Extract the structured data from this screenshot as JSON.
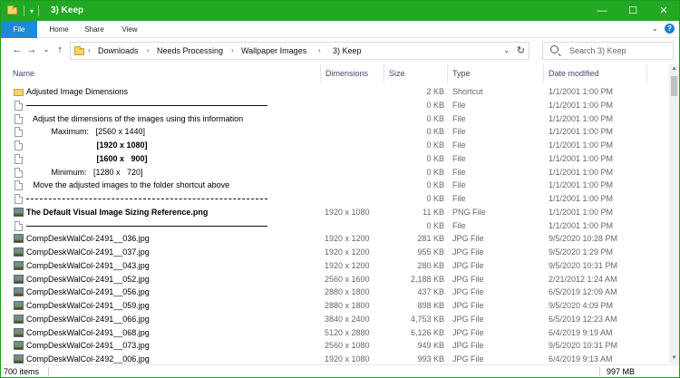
{
  "window": {
    "title": "3) Keep",
    "controls": {
      "minimize": "—",
      "maximize": "☐",
      "close": "✕"
    }
  },
  "ribbon": {
    "tabs": [
      "File",
      "Home",
      "Share",
      "View"
    ]
  },
  "navigation": {
    "back": "←",
    "forward": "→",
    "recent": "⌄",
    "up": "↑",
    "breadcrumb": [
      "Downloads",
      "Needs Processing",
      "Wallpaper Images",
      "3) Keep"
    ],
    "search_placeholder": "Search  3) Keep"
  },
  "columns": {
    "name": "Name",
    "dimensions": "Dimensions",
    "size": "Size",
    "type": "Type",
    "date": "Date modified"
  },
  "files": [
    {
      "icon": "folder-shortcut-icon",
      "name": "Adjusted Image Dimensions",
      "dim": "",
      "size": "2 KB",
      "type": "Shortcut",
      "date": "1/1/2001 1:00 PM",
      "style": "plain"
    },
    {
      "icon": "blank-file-icon",
      "name": "",
      "dim": "",
      "size": "0 KB",
      "type": "File",
      "date": "1/1/2001 1:00 PM",
      "style": "rule-solid"
    },
    {
      "icon": "blank-file-icon",
      "name": "   Adjust the dimensions of the images using this information",
      "dim": "",
      "size": "0 KB",
      "type": "File",
      "date": "1/1/2001 1:00 PM",
      "style": "plain"
    },
    {
      "icon": "blank-file-icon",
      "name": "           Maximum:   [2560 x 1440]",
      "dim": "",
      "size": "0 KB",
      "type": "File",
      "date": "1/1/2001 1:00 PM",
      "style": "plain"
    },
    {
      "icon": "blank-file-icon",
      "name": "                               [1920 x 1080]",
      "dim": "",
      "size": "0 KB",
      "type": "File",
      "date": "1/1/2001 1:00 PM",
      "style": "plain"
    },
    {
      "icon": "blank-file-icon",
      "name": "                               [1600 x   900]",
      "dim": "",
      "size": "0 KB",
      "type": "File",
      "date": "1/1/2001 1:00 PM",
      "style": "plain"
    },
    {
      "icon": "blank-file-icon",
      "name": "           Minimum:   [1280 x   720]",
      "dim": "",
      "size": "0 KB",
      "type": "File",
      "date": "1/1/2001 1:00 PM",
      "style": "plain"
    },
    {
      "icon": "blank-file-icon",
      "name": "   Move the adjusted images to the folder shortcut above",
      "dim": "",
      "size": "0 KB",
      "type": "File",
      "date": "1/1/2001 1:00 PM",
      "style": "plain"
    },
    {
      "icon": "blank-file-icon",
      "name": "",
      "dim": "",
      "size": "0 KB",
      "type": "File",
      "date": "1/1/2001 1:00 PM",
      "style": "rule-dash"
    },
    {
      "icon": "image-file-icon",
      "name": "The Default Visual Image Sizing Reference.png",
      "dim": "1920 x 1080",
      "size": "11 KB",
      "type": "PNG File",
      "date": "1/1/2001 1:00 PM",
      "style": "bold"
    },
    {
      "icon": "blank-file-icon",
      "name": "",
      "dim": "",
      "size": "0 KB",
      "type": "File",
      "date": "1/1/2001 1:00 PM",
      "style": "rule-solid"
    },
    {
      "icon": "image-file-icon",
      "name": "CompDeskWalCol-2491__036.jpg",
      "dim": "1920 x 1200",
      "size": "281 KB",
      "type": "JPG File",
      "date": "9/5/2020 10:28 PM",
      "style": "plain"
    },
    {
      "icon": "image-file-icon",
      "name": "CompDeskWalCol-2491__037.jpg",
      "dim": "1920 x 1200",
      "size": "955 KB",
      "type": "JPG File",
      "date": "9/5/2020 1:29 PM",
      "style": "plain"
    },
    {
      "icon": "image-file-icon",
      "name": "CompDeskWalCol-2491__043.jpg",
      "dim": "1920 x 1200",
      "size": "280 KB",
      "type": "JPG File",
      "date": "9/5/2020 10:31 PM",
      "style": "plain"
    },
    {
      "icon": "image-file-icon",
      "name": "CompDeskWalCol-2491__052.jpg",
      "dim": "2560 x 1600",
      "size": "2,188 KB",
      "type": "JPG File",
      "date": "2/21/2012 1:24 AM",
      "style": "plain"
    },
    {
      "icon": "image-file-icon",
      "name": "CompDeskWalCol-2491__056.jpg",
      "dim": "2880 x 1800",
      "size": "437 KB",
      "type": "JPG File",
      "date": "6/5/2019 12:09 AM",
      "style": "plain"
    },
    {
      "icon": "image-file-icon",
      "name": "CompDeskWalCol-2491__059.jpg",
      "dim": "2880 x 1800",
      "size": "898 KB",
      "type": "JPG File",
      "date": "9/5/2020 4:09 PM",
      "style": "plain"
    },
    {
      "icon": "image-file-icon",
      "name": "CompDeskWalCol-2491__066.jpg",
      "dim": "3840 x 2400",
      "size": "4,753 KB",
      "type": "JPG File",
      "date": "6/5/2019 12:23 AM",
      "style": "plain"
    },
    {
      "icon": "image-file-icon",
      "name": "CompDeskWalCol-2491__068.jpg",
      "dim": "5120 x 2880",
      "size": "6,126 KB",
      "type": "JPG File",
      "date": "6/4/2019 9:19 AM",
      "style": "plain"
    },
    {
      "icon": "image-file-icon",
      "name": "CompDeskWalCol-2491__073.jpg",
      "dim": "2560 x 1080",
      "size": "949 KB",
      "type": "JPG File",
      "date": "9/5/2020 10:31 PM",
      "style": "plain"
    },
    {
      "icon": "image-file-icon",
      "name": "CompDeskWalCol-2492__006.jpg",
      "dim": "1920 x 1080",
      "size": "993 KB",
      "type": "JPG File",
      "date": "6/4/2019 9:13 AM",
      "style": "plain"
    }
  ],
  "status": {
    "item_count": "700 items",
    "total_size": "997 MB"
  }
}
